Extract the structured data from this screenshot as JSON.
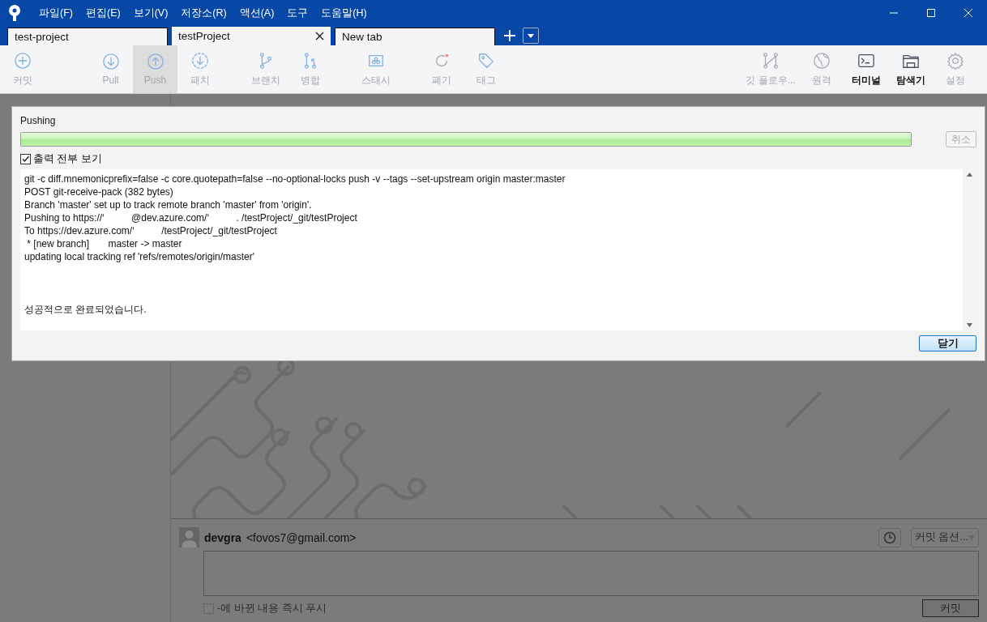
{
  "window": {
    "menu": [
      "파일(F)",
      "편집(E)",
      "보기(V)",
      "저장소(R)",
      "액션(A)",
      "도구",
      "도움말(H)"
    ]
  },
  "tabs": [
    {
      "label": "test-project",
      "selected": false
    },
    {
      "label": "testProject",
      "selected": true
    },
    {
      "label": "New tab",
      "selected": false
    }
  ],
  "toolbar": {
    "left_groups": [
      [
        {
          "label": "커밋",
          "disabled": true,
          "selected": false
        }
      ],
      [
        {
          "label": "Pull",
          "disabled": true,
          "selected": false
        },
        {
          "label": "Push",
          "disabled": true,
          "selected": true
        },
        {
          "label": "패치",
          "disabled": true,
          "selected": false
        }
      ],
      [
        {
          "label": "브랜치",
          "disabled": true,
          "selected": false
        },
        {
          "label": "병합",
          "disabled": true,
          "selected": false
        }
      ],
      [
        {
          "label": "스태시",
          "disabled": true,
          "selected": false
        }
      ],
      [
        {
          "label": "폐기",
          "disabled": true,
          "selected": false
        },
        {
          "label": "태그",
          "disabled": true,
          "selected": false
        }
      ]
    ],
    "right": [
      {
        "label": "깃 플로우...",
        "disabled": true
      },
      {
        "label": "원격",
        "disabled": true
      },
      {
        "label": "터미널",
        "disabled": false
      },
      {
        "label": "탐색기",
        "disabled": false
      },
      {
        "label": "설정",
        "disabled": true
      }
    ]
  },
  "dialog": {
    "title": "Pushing",
    "progress": {
      "level": 1
    },
    "cancel_button": {
      "label": "취소",
      "disabled": true
    },
    "show_all_output": {
      "label": "출력 전부 보기",
      "checked": true
    },
    "output_lines": [
      "git -c diff.mnemonicprefix=false -c core.quotepath=false --no-optional-locks push -v --tags --set-upstream origin master:master",
      "POST git-receive-pack (382 bytes)",
      "Branch 'master' set up to track remote branch 'master' from 'origin'.",
      "Pushing to https://‘          @dev.azure.com/‘          . /testProject/_git/testProject",
      "To https://dev.azure.com/‘          /testProject/_git/testProject",
      " * [new branch]       master -> master",
      "updating local tracking ref 'refs/remotes/origin/master'"
    ],
    "final_message": "성공적으로 완료되었습니다.",
    "close_button": {
      "label": "닫기"
    }
  },
  "commit_panel": {
    "author_name": "devgra",
    "author_email": "<fovos7@gmail.com>",
    "options_dropdown": "커밋 옵션...",
    "push_immediately": {
      "label": "-에 바뀐 내용 즉시 푸시",
      "checked": false
    },
    "commit_button": "커밋"
  }
}
